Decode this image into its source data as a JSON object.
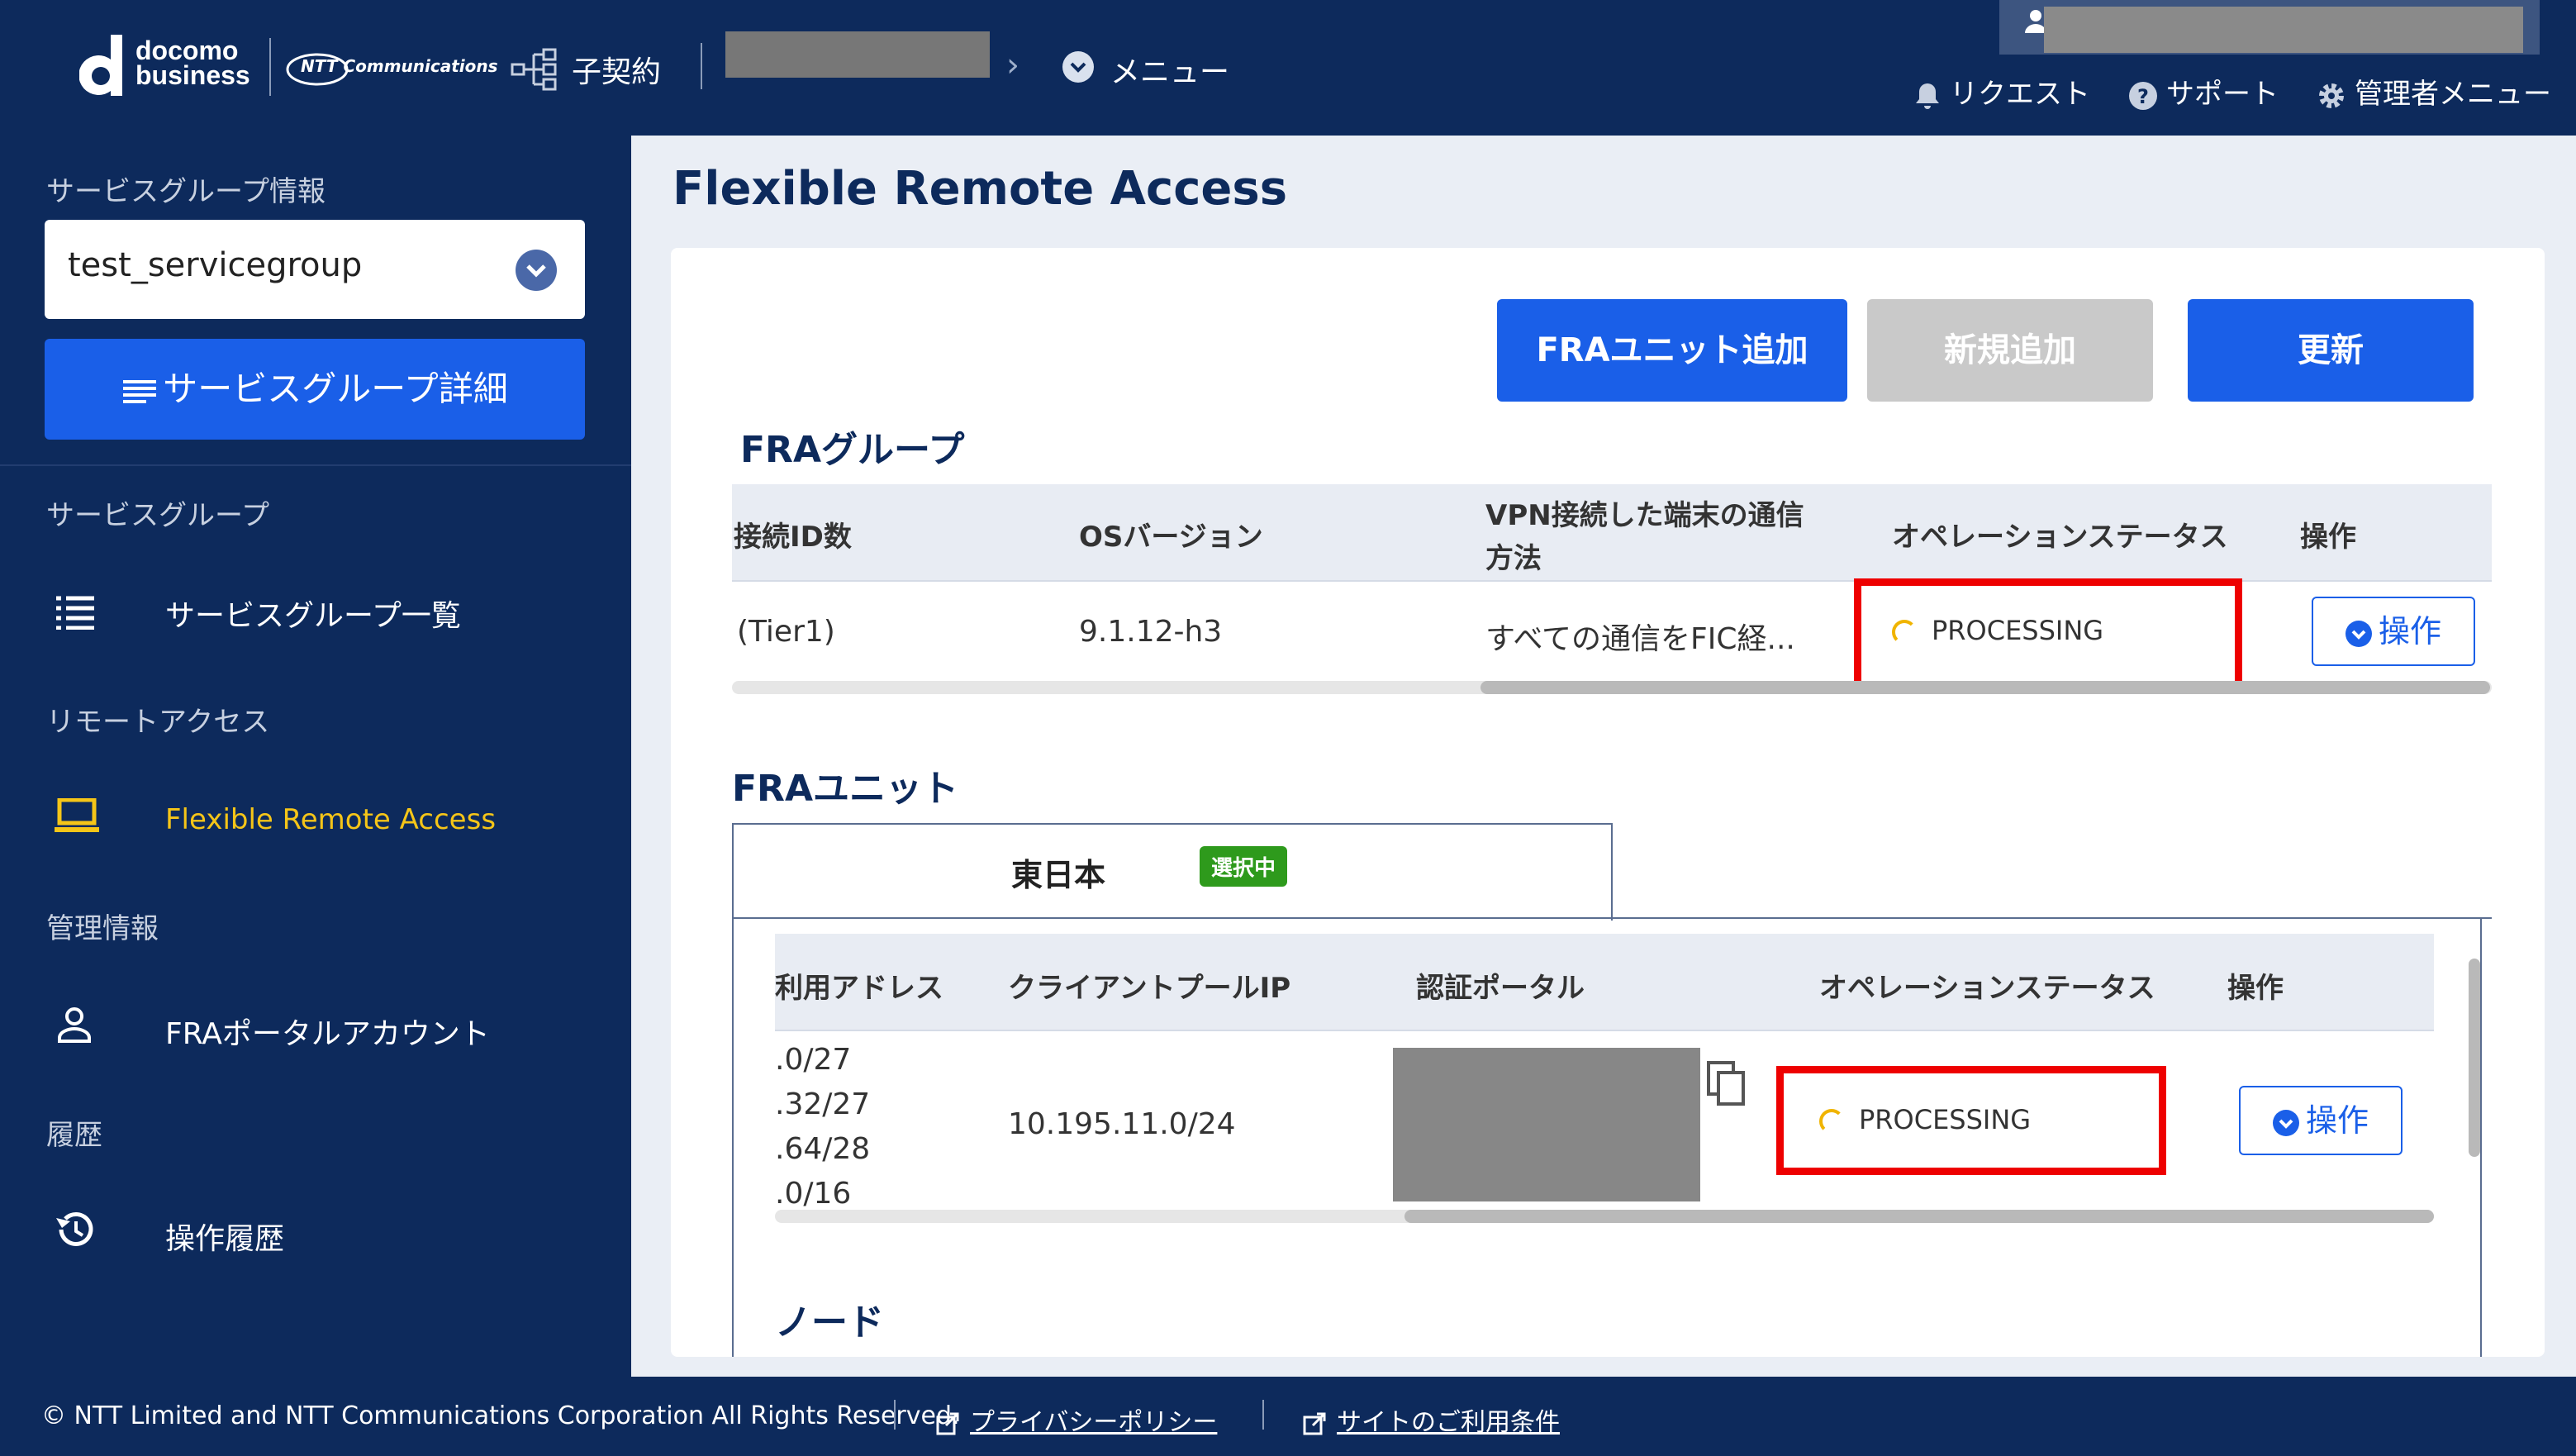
{
  "header": {
    "brand_docomo": "docomo",
    "brand_business": "business",
    "brand_ntt": "NTT Communications",
    "contract_label": "子契約",
    "menu_label": "メニュー",
    "request_label": "リクエスト",
    "support_label": "サポート",
    "admin_menu_label": "管理者メニュー"
  },
  "sidebar": {
    "sg_info_label": "サービスグループ情報",
    "sg_select_value": "test_servicegroup",
    "sg_detail_button": "サービスグループ詳細",
    "sections": [
      {
        "title": "サービスグループ",
        "item": "サービスグループ一覧",
        "icon": "list-icon"
      },
      {
        "title": "リモートアクセス",
        "item": "Flexible Remote Access",
        "icon": "laptop-icon"
      },
      {
        "title": "管理情報",
        "item": "FRAポータルアカウント",
        "icon": "person-icon"
      },
      {
        "title": "履歴",
        "item": "操作履歴",
        "icon": "history-icon"
      }
    ],
    "active_color": "#f5c518"
  },
  "main": {
    "title": "Flexible Remote Access",
    "buttons": {
      "add_fra_unit": "FRAユニット追加",
      "new_add": "新規追加",
      "refresh": "更新"
    },
    "fra_group": {
      "title": "FRAグループ",
      "headers": [
        "接続ID数",
        "OSバージョン",
        "VPN接続した端末の通信",
        "方法",
        "オペレーションステータス",
        "操作"
      ],
      "row": {
        "connection_ids": "(Tier1)",
        "os_version": "9.1.12-h3",
        "vpn_method": "すべての通信をFIC経...",
        "status": "PROCESSING",
        "action": "操作"
      }
    },
    "fra_unit": {
      "title": "FRAユニット",
      "tab_label": "東日本",
      "tab_badge": "選択中",
      "headers": [
        "利用アドレス",
        "クライアントプールIP",
        "認証ポータル",
        "オペレーションステータス",
        "操作"
      ],
      "row": {
        "addresses": [
          ".0/27",
          ".32/27",
          ".64/28",
          ".0/16"
        ],
        "client_pool_ip": "10.195.11.0/24",
        "status": "PROCESSING",
        "action": "操作"
      },
      "next_section": "ノード"
    }
  },
  "footer": {
    "copyright": "© NTT Limited and NTT Communications Corporation All Rights Reserved.",
    "privacy": "プライバシーポリシー",
    "terms": "サイトのご利用条件"
  },
  "colors": {
    "navy": "#0d2a5c",
    "primary_blue": "#1a5fe8",
    "highlight_red": "#ee0000",
    "badge_green": "#2e9a1c"
  }
}
